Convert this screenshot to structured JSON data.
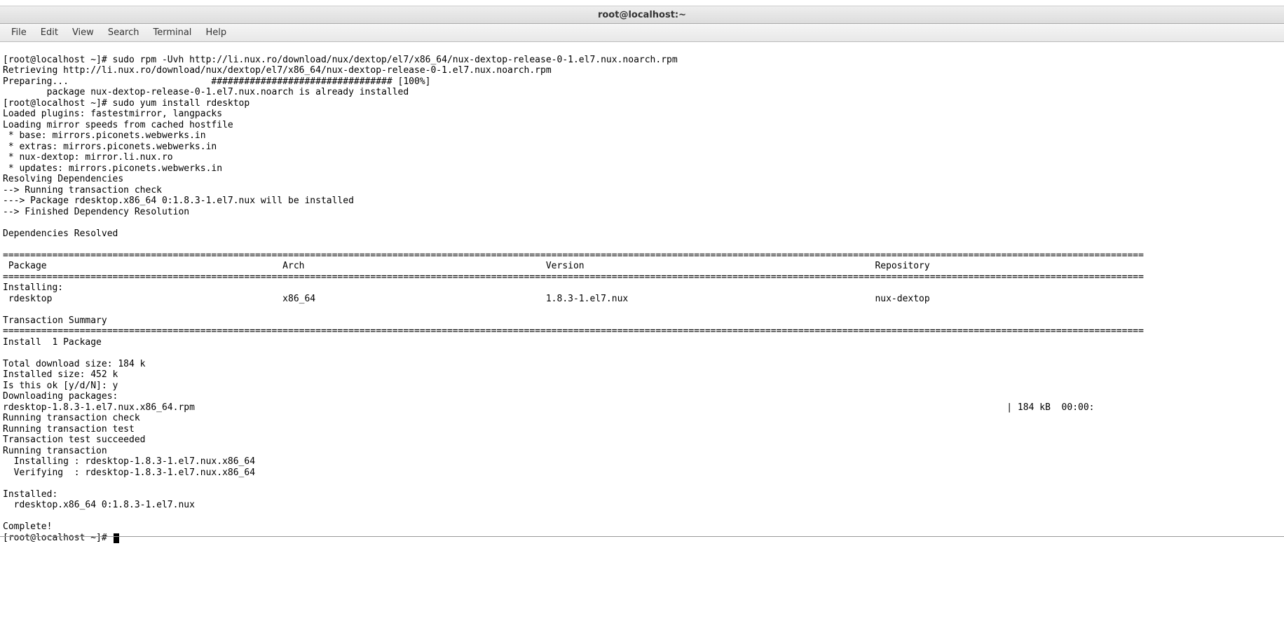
{
  "titlebar": {
    "title": "root@localhost:~"
  },
  "menubar": {
    "items": [
      "File",
      "Edit",
      "View",
      "Search",
      "Terminal",
      "Help"
    ]
  },
  "terminal": {
    "lines": [
      "[root@localhost ~]# sudo rpm -Uvh http://li.nux.ro/download/nux/dextop/el7/x86_64/nux-dextop-release-0-1.el7.nux.noarch.rpm",
      "Retrieving http://li.nux.ro/download/nux/dextop/el7/x86_64/nux-dextop-release-0-1.el7.nux.noarch.rpm",
      "Preparing...                          ################################# [100%]",
      "        package nux-dextop-release-0-1.el7.nux.noarch is already installed",
      "[root@localhost ~]# sudo yum install rdesktop",
      "Loaded plugins: fastestmirror, langpacks",
      "Loading mirror speeds from cached hostfile",
      " * base: mirrors.piconets.webwerks.in",
      " * extras: mirrors.piconets.webwerks.in",
      " * nux-dextop: mirror.li.nux.ro",
      " * updates: mirrors.piconets.webwerks.in",
      "Resolving Dependencies",
      "--> Running transaction check",
      "---> Package rdesktop.x86_64 0:1.8.3-1.el7.nux will be installed",
      "--> Finished Dependency Resolution",
      "",
      "Dependencies Resolved",
      "",
      "================================================================================================================================================================================================================",
      " Package                                           Arch                                            Version                                                     Repository                                       ",
      "================================================================================================================================================================================================================",
      "Installing:",
      " rdesktop                                          x86_64                                          1.8.3-1.el7.nux                                             nux-dextop                                      ",
      "",
      "Transaction Summary",
      "================================================================================================================================================================================================================",
      "Install  1 Package",
      "",
      "Total download size: 184 k",
      "Installed size: 452 k",
      "Is this ok [y/d/N]: y",
      "Downloading packages:",
      "rdesktop-1.8.3-1.el7.nux.x86_64.rpm                                                                                                                                                    | 184 kB  00:00:",
      "Running transaction check",
      "Running transaction test",
      "Transaction test succeeded",
      "Running transaction",
      "  Installing : rdesktop-1.8.3-1.el7.nux.x86_64                                                                                                                                                             ",
      "  Verifying  : rdesktop-1.8.3-1.el7.nux.x86_64                                                                                                                                                             ",
      "",
      "Installed:",
      "  rdesktop.x86_64 0:1.8.3-1.el7.nux",
      "",
      "Complete!"
    ],
    "prompt": "[root@localhost ~]# "
  }
}
